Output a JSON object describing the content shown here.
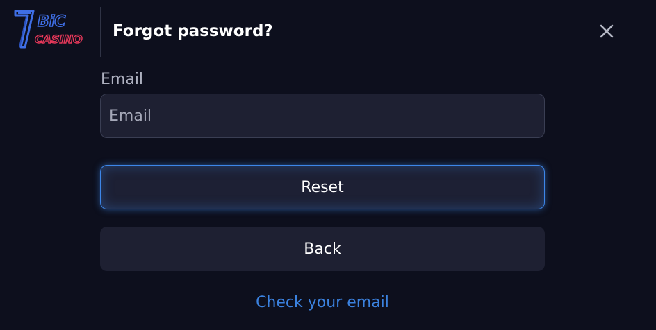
{
  "logo": {
    "brand_number": "7",
    "brand_bit": "BiC",
    "brand_casino": "CASINO",
    "colors": {
      "blue": "#3f6fe6",
      "red": "#e8385a"
    }
  },
  "header": {
    "title": "Forgot password?",
    "close_icon": "close-icon"
  },
  "form": {
    "email_label": "Email",
    "email_placeholder": "Email",
    "email_value": ""
  },
  "actions": {
    "reset_label": "Reset",
    "back_label": "Back",
    "check_email_link": "Check your email"
  },
  "colors": {
    "background": "#0d0f1d",
    "surface": "#1e2032",
    "accent_blue": "#3d86e8",
    "link_blue": "#3b82e0"
  }
}
